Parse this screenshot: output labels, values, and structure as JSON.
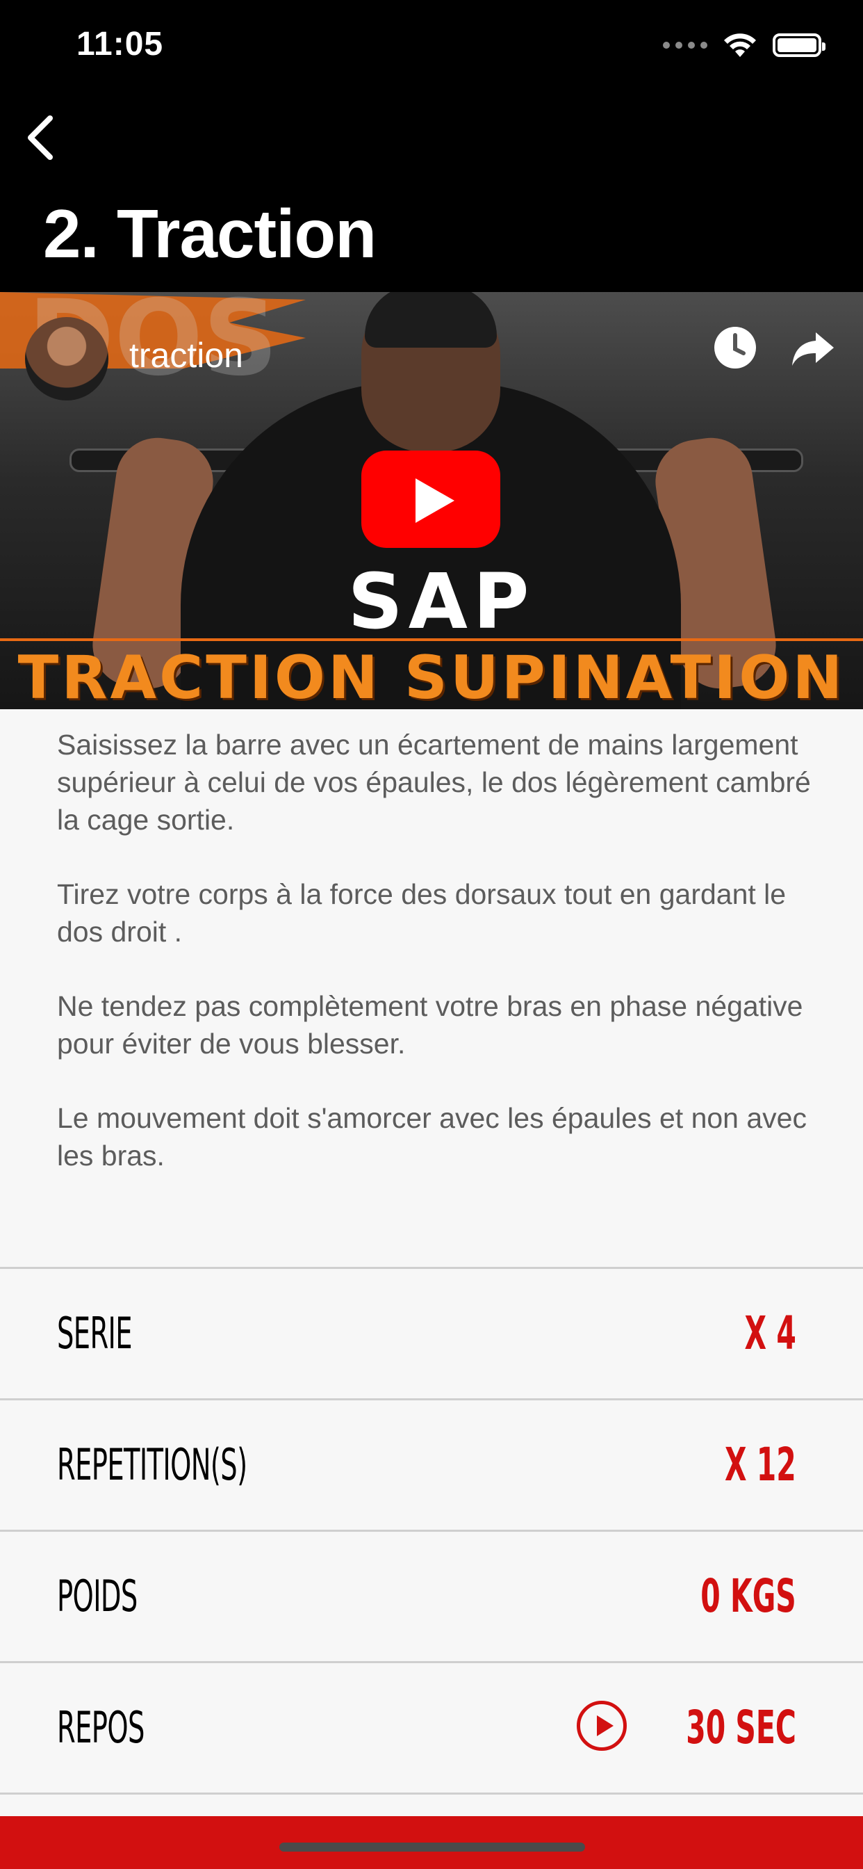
{
  "status_bar": {
    "time": "11:05"
  },
  "header": {
    "title": "2. Traction"
  },
  "video": {
    "channel_name": "traction",
    "overlay_title": "TRACTION SUPINATION",
    "logo_text": "SAP",
    "background_word": "DOS"
  },
  "description": {
    "paragraphs": [
      "Saisissez la barre avec un écartement de mains largement supérieur à celui de vos épaules, le dos légèrement cambré la cage sortie.",
      "Tirez  votre corps à la force des dorsaux tout en gardant le dos droit .",
      "Ne tendez pas complètement votre bras en phase négative pour éviter de vous blesser.",
      "Le mouvement doit s'amorcer avec les épaules et non avec les bras."
    ]
  },
  "stats": [
    {
      "label": "SERIE",
      "value": "X 4"
    },
    {
      "label": "REPETITION(S)",
      "value": "X 12"
    },
    {
      "label": "POIDS",
      "value": "0 KGS"
    },
    {
      "label": "REPOS",
      "value": "30 SEC"
    }
  ],
  "colors": {
    "accent": "#d21010",
    "video_title": "#f28a1e",
    "header_bg": "#000000"
  }
}
